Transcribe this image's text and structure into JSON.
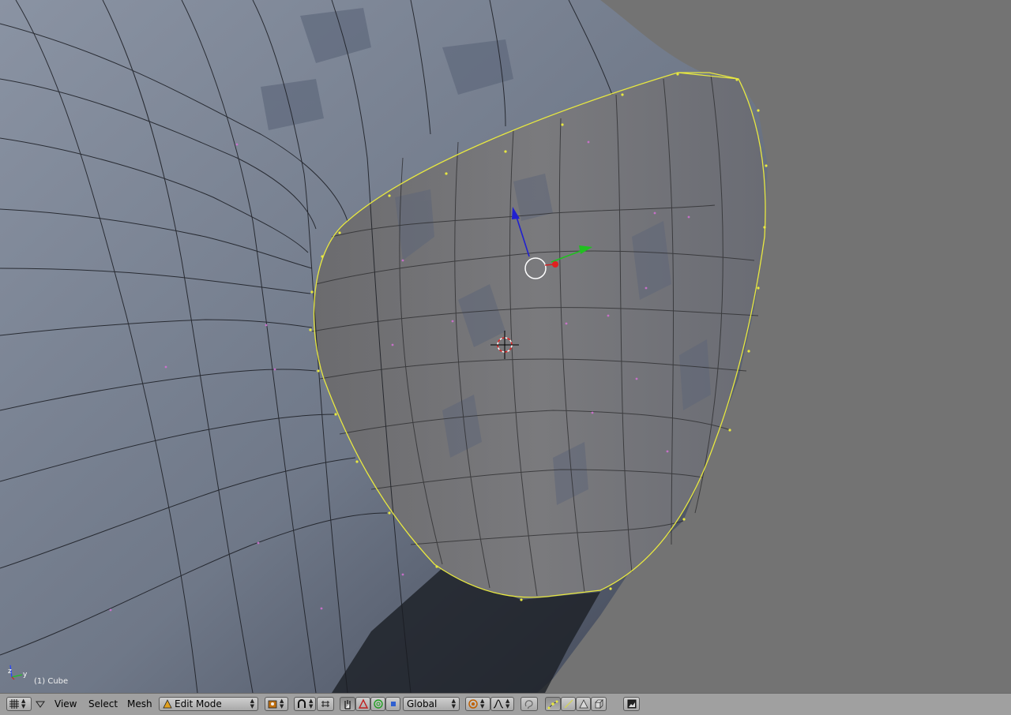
{
  "viewport": {
    "object_label": "(1) Cube",
    "axis_labels": {
      "z": "z",
      "y": "y"
    }
  },
  "header": {
    "menus": {
      "view": "View",
      "select": "Select",
      "mesh": "Mesh"
    },
    "mode_selector": {
      "value": "Edit Mode"
    },
    "orientation_selector": {
      "value": "Global"
    }
  },
  "colors": {
    "background": "#737373",
    "mesh_surface": "#7d8595",
    "selected_edge": "#e8e840",
    "header": "#a0a0a0",
    "manipulator_z": "#2020d0",
    "manipulator_y": "#20c020",
    "manipulator_x": "#d02020"
  }
}
